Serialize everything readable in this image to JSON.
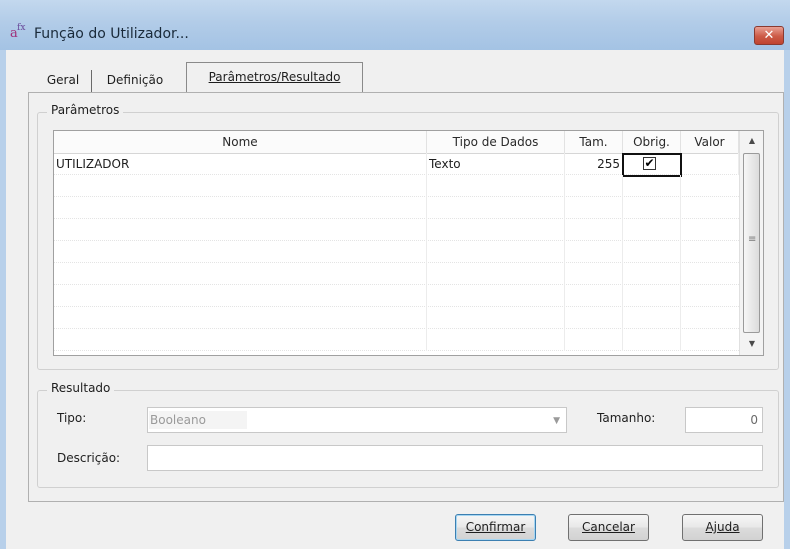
{
  "window": {
    "title": "Função do Utilizador...",
    "close_glyph": "✕",
    "app_icon": "function-icon"
  },
  "tabs": [
    {
      "label": "Geral",
      "active": false
    },
    {
      "label": "Definição",
      "active": false
    },
    {
      "label": "Parâmetros/Resultado",
      "active": true
    }
  ],
  "parametros": {
    "group_label": "Parâmetros",
    "columns": [
      "Nome",
      "Tipo de Dados",
      "Tam.",
      "Obrig.",
      "Valor"
    ],
    "rows": [
      {
        "nome": "UTILIZADOR",
        "tipo": "Texto",
        "tam": "255",
        "obrig": true,
        "valor": ""
      }
    ],
    "check_glyph": "✔",
    "scroll_up_glyph": "▲",
    "scroll_down_glyph": "▼",
    "scroll_grip_glyph": "≡"
  },
  "resultado": {
    "group_label": "Resultado",
    "tipo_label": "Tipo:",
    "tipo_value": "Booleano",
    "tipo_arrow": "▼",
    "tamanho_label": "Tamanho:",
    "tamanho_value": "0",
    "descricao_label": "Descrição:",
    "descricao_value": ""
  },
  "buttons": {
    "confirmar": "Confirmar",
    "cancelar": "Cancelar",
    "ajuda": "Ajuda"
  }
}
